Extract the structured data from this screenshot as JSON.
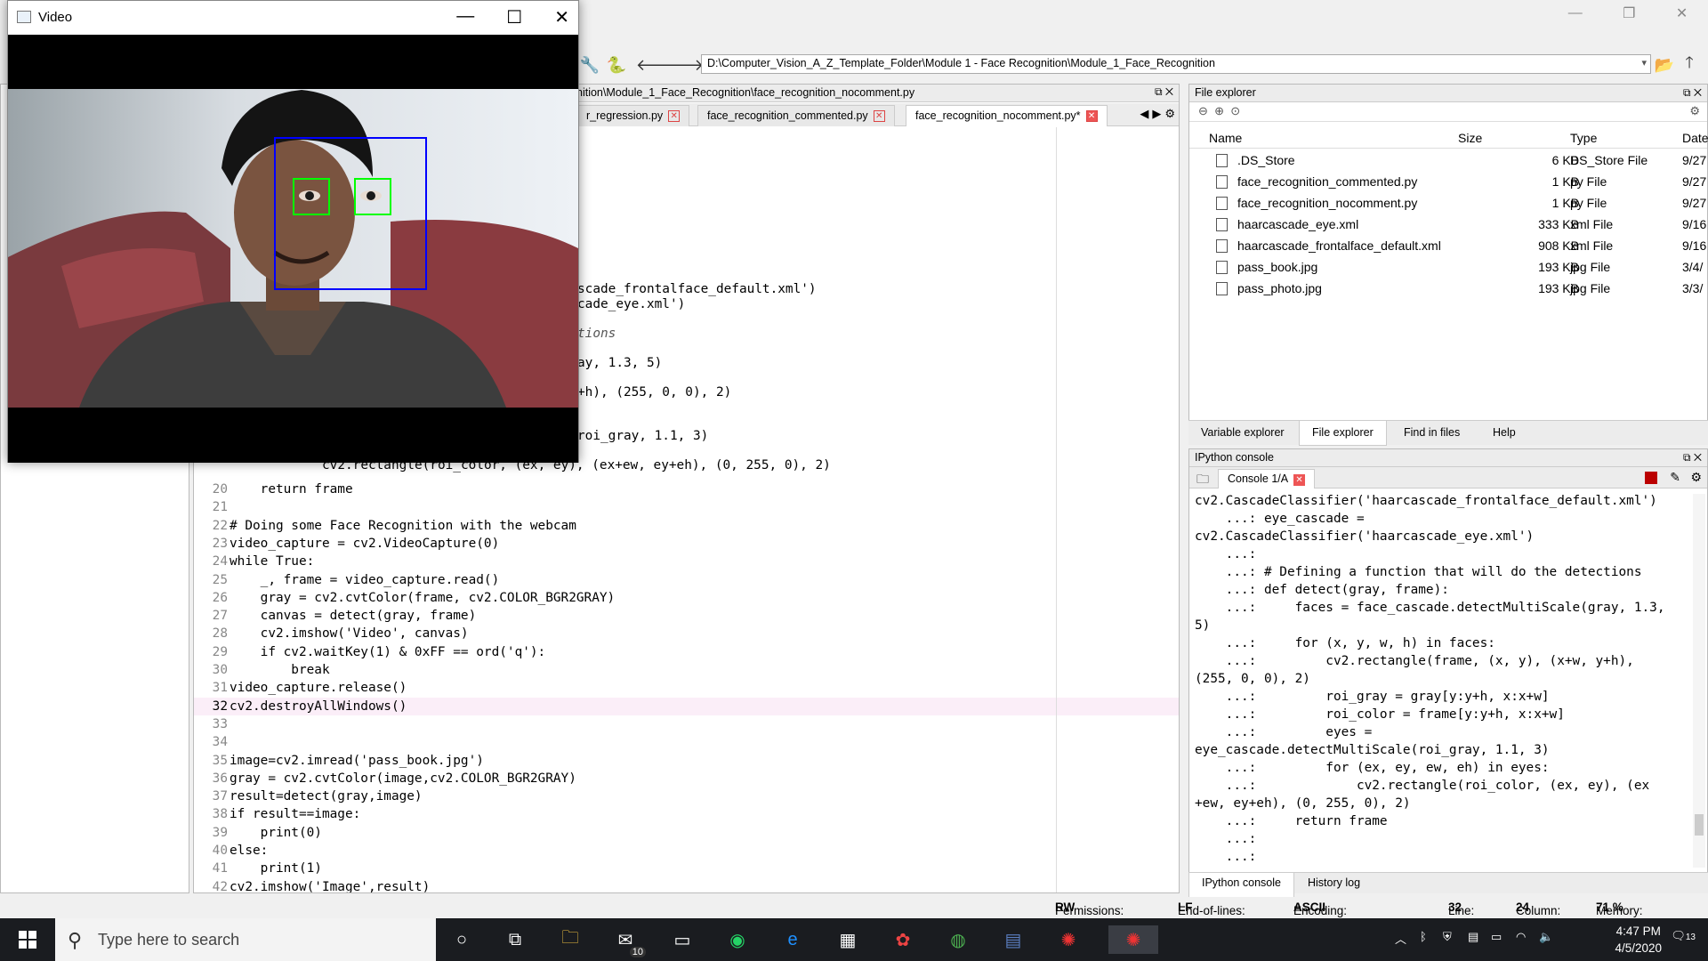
{
  "toolbar": {
    "path": "D:\\Computer_Vision_A_Z_Template_Folder\\Module 1 - Face Recognition\\Module_1_Face_Recognition"
  },
  "editor": {
    "path_partial": "nition\\Module_1_Face_Recognition\\face_recognition_nocomment.py",
    "tabs": [
      {
        "label": "r_regression.py"
      },
      {
        "label": "face_recognition_commented.py"
      },
      {
        "label": "face_recognition_nocomment.py*"
      }
    ],
    "partial_lines": [
      "scade_frontalface_default.xml')",
      "cade_eye.xml')",
      "tions",
      "ay, 1.3, 5)",
      "+h), (255, 0, 0), 2)",
      "roi_gray, 1.1, 3)",
      "cv2.rectangle(roi_color, (ex, ey), (ex+ew, ey+eh), (0, 255, 0), 2)"
    ],
    "lines": [
      {
        "n": "20",
        "t": "    return frame"
      },
      {
        "n": "21",
        "t": ""
      },
      {
        "n": "22",
        "t": "# Doing some Face Recognition with the webcam"
      },
      {
        "n": "23",
        "t": "video_capture = cv2.VideoCapture(0)"
      },
      {
        "n": "24",
        "t": "while True:"
      },
      {
        "n": "25",
        "t": "    _, frame = video_capture.read()"
      },
      {
        "n": "26",
        "t": "    gray = cv2.cvtColor(frame, cv2.COLOR_BGR2GRAY)"
      },
      {
        "n": "27",
        "t": "    canvas = detect(gray, frame)"
      },
      {
        "n": "28",
        "t": "    cv2.imshow('Video', canvas)"
      },
      {
        "n": "29",
        "t": "    if cv2.waitKey(1) & 0xFF == ord('q'):"
      },
      {
        "n": "30",
        "t": "        break"
      },
      {
        "n": "31",
        "t": "video_capture.release()"
      },
      {
        "n": "32",
        "t": "cv2.destroyAllWindows()"
      },
      {
        "n": "33",
        "t": ""
      },
      {
        "n": "34",
        "t": ""
      },
      {
        "n": "35",
        "t": "image=cv2.imread('pass_book.jpg')"
      },
      {
        "n": "36",
        "t": "gray = cv2.cvtColor(image,cv2.COLOR_BGR2GRAY)"
      },
      {
        "n": "37",
        "t": "result=detect(gray,image)"
      },
      {
        "n": "38",
        "t": "if result==image:"
      },
      {
        "n": "39",
        "t": "    print(0)"
      },
      {
        "n": "40",
        "t": "else:"
      },
      {
        "n": "41",
        "t": "    print(1)"
      },
      {
        "n": "42",
        "t": "cv2.imshow('Image',result)"
      }
    ]
  },
  "file_explorer": {
    "title": "File explorer",
    "headers": {
      "name": "Name",
      "size": "Size",
      "type": "Type",
      "date": "Date"
    },
    "files": [
      {
        "name": ".DS_Store",
        "size": "6 KB",
        "type": "DS_Store File",
        "date": "9/27"
      },
      {
        "name": "face_recognition_commented.py",
        "size": "1 KB",
        "type": "py File",
        "date": "9/27"
      },
      {
        "name": "face_recognition_nocomment.py",
        "size": "1 KB",
        "type": "py File",
        "date": "9/27"
      },
      {
        "name": "haarcascade_eye.xml",
        "size": "333 KB",
        "type": "xml File",
        "date": "9/16"
      },
      {
        "name": "haarcascade_frontalface_default.xml",
        "size": "908 KB",
        "type": "xml File",
        "date": "9/16"
      },
      {
        "name": "pass_book.jpg",
        "size": "193 KB",
        "type": "jpg File",
        "date": "3/4/"
      },
      {
        "name": "pass_photo.jpg",
        "size": "193 KB",
        "type": "jpg File",
        "date": "3/3/"
      }
    ],
    "bottom_tabs": [
      "Variable explorer",
      "File explorer",
      "Find in files",
      "Help"
    ]
  },
  "ipython": {
    "title": "IPython console",
    "tab": "Console 1/A",
    "lines": [
      "cv2.CascadeClassifier('haarcascade_frontalface_default.xml')",
      "    ...: eye_cascade =",
      "cv2.CascadeClassifier('haarcascade_eye.xml')",
      "    ...:",
      "    ...: # Defining a function that will do the detections",
      "    ...: def detect(gray, frame):",
      "    ...:     faces = face_cascade.detectMultiScale(gray, 1.3,",
      "5)",
      "    ...:     for (x, y, w, h) in faces:",
      "    ...:         cv2.rectangle(frame, (x, y), (x+w, y+h),",
      "(255, 0, 0), 2)",
      "    ...:         roi_gray = gray[y:y+h, x:x+w]",
      "    ...:         roi_color = frame[y:y+h, x:x+w]",
      "    ...:         eyes =",
      "eye_cascade.detectMultiScale(roi_gray, 1.1, 3)",
      "    ...:         for (ex, ey, ew, eh) in eyes:",
      "    ...:             cv2.rectangle(roi_color, (ex, ey), (ex",
      "+ew, ey+eh), (0, 255, 0), 2)",
      "    ...:     return frame",
      "    ...:",
      "    ...:"
    ],
    "bottom_tabs": [
      "IPython console",
      "History log"
    ]
  },
  "status": {
    "permissions_label": "Permissions:",
    "permissions": "RW",
    "eol_label": "End-of-lines:",
    "eol": "LF",
    "encoding_label": "Encoding:",
    "encoding": "ASCII",
    "line_label": "Line:",
    "line": "32",
    "column_label": "Column:",
    "column": "24",
    "memory_label": "Memory:",
    "memory": "71 %"
  },
  "video_window": {
    "title": "Video",
    "face_box_color": "#0000ff",
    "eye_box_color": "#00ff00"
  },
  "taskbar": {
    "search_placeholder": "Type here to search",
    "mail_badge": "10",
    "time": "4:47 PM",
    "date": "4/5/2020",
    "notif_count": "13"
  }
}
